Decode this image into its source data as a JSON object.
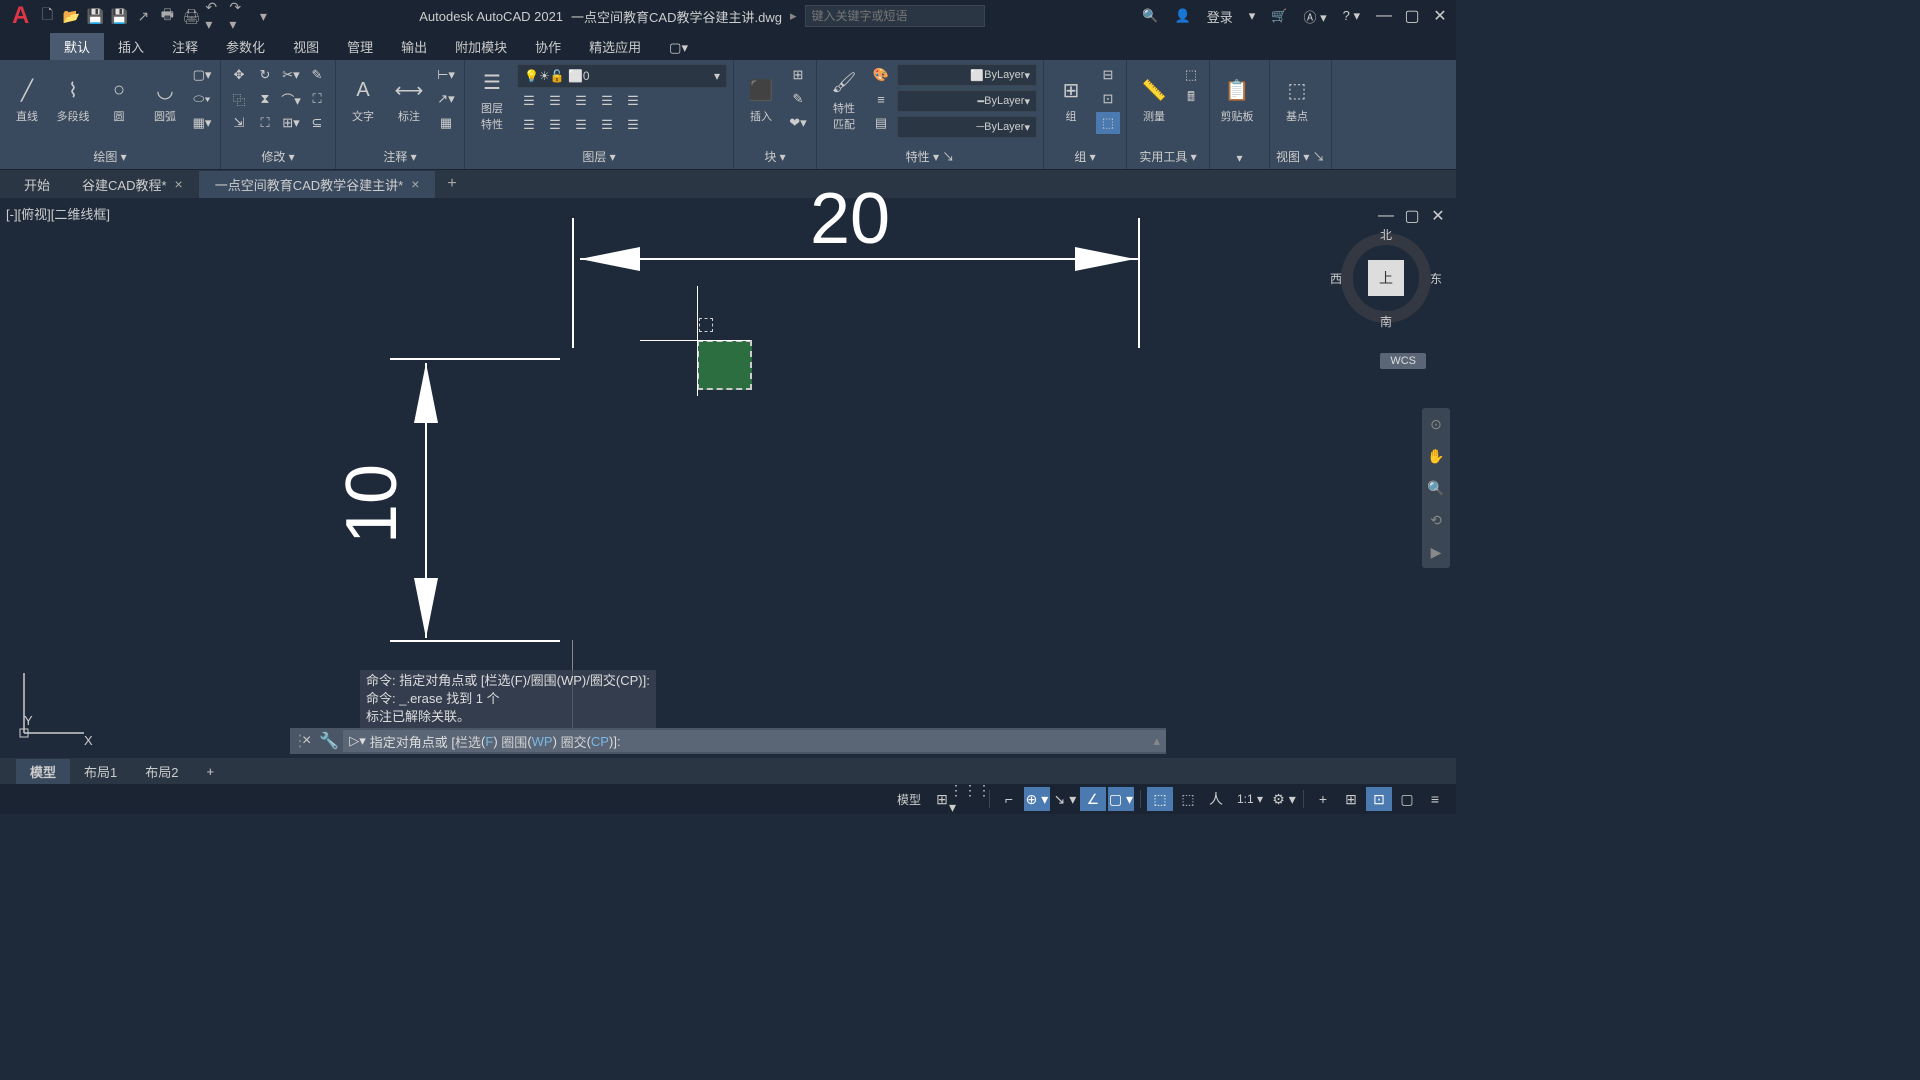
{
  "app": {
    "name": "Autodesk AutoCAD 2021",
    "doc": "一点空间教育CAD教学谷建主讲.dwg",
    "search_placeholder": "键入关键字或短语",
    "login": "登录"
  },
  "ribbon_tabs": [
    "默认",
    "插入",
    "注释",
    "参数化",
    "视图",
    "管理",
    "输出",
    "附加模块",
    "协作",
    "精选应用"
  ],
  "panels": {
    "draw": {
      "title": "绘图",
      "line": "直线",
      "pline": "多段线",
      "circle": "圆",
      "arc": "圆弧"
    },
    "modify": {
      "title": "修改"
    },
    "annot": {
      "title": "注释",
      "text": "文字",
      "dim": "标注"
    },
    "layer": {
      "title": "图层",
      "props": "图层\n特性",
      "current": "0"
    },
    "block": {
      "title": "块",
      "insert": "插入"
    },
    "props": {
      "title": "特性",
      "match": "特性\n匹配",
      "bylayer": "ByLayer"
    },
    "group": {
      "title": "组",
      "group": "组"
    },
    "util": {
      "title": "实用工具",
      "measure": "测量"
    },
    "clip": {
      "title": "剪贴板",
      "paste": "剪贴板"
    },
    "view": {
      "title": "视图",
      "base": "基点"
    }
  },
  "file_tabs": {
    "start": "开始",
    "t1": "谷建CAD教程*",
    "t2": "一点空间教育CAD教学谷建主讲*"
  },
  "viewport": {
    "label": "[-][俯视][二维线框]"
  },
  "viewcube": {
    "n": "北",
    "s": "南",
    "e": "东",
    "w": "西",
    "top": "上",
    "wcs": "WCS"
  },
  "dims": {
    "h": "20",
    "v": "10"
  },
  "ucs": {
    "x": "X",
    "y": "Y"
  },
  "cmd_history": {
    "l1": "命令: 指定对角点或 [栏选(F)/圈围(WP)/圈交(CP)]:",
    "l2": "命令: _.erase 找到 1 个",
    "l3": "标注已解除关联。"
  },
  "cmdline": {
    "prefix": "指定对角点或 [",
    "o1": "栏选",
    "k1": "F",
    "o2": "圈围",
    "k2": "WP",
    "o3": "圈交",
    "k3": "CP",
    "suffix": "]:"
  },
  "layout_tabs": {
    "model": "模型",
    "l1": "布局1",
    "l2": "布局2"
  },
  "status": {
    "model": "模型",
    "scale": "1:1"
  }
}
